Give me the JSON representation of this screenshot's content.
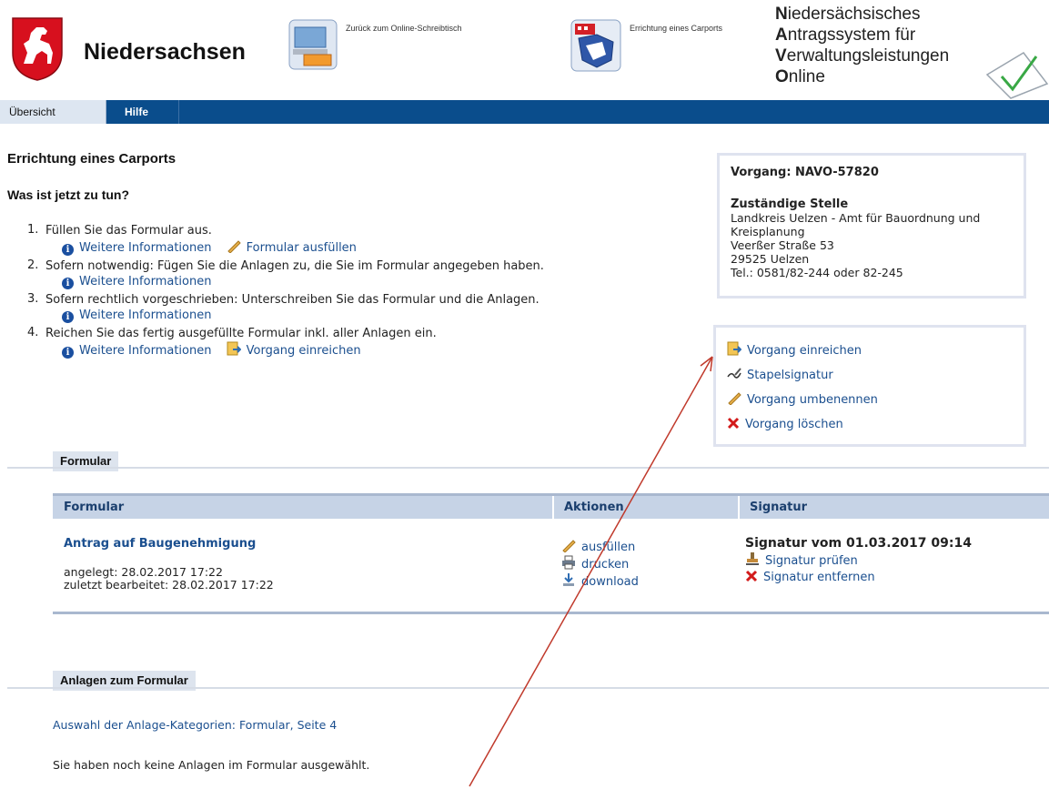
{
  "header": {
    "brand": "Niedersachsen",
    "back_link": "Zurück zum Online-Schreibtisch",
    "service_link": "Errichtung eines Carports",
    "navo_lines": [
      {
        "initial": "N",
        "rest": "iedersächsisches"
      },
      {
        "initial": "A",
        "rest": "ntragssystem für"
      },
      {
        "initial": "V",
        "rest": "erwaltungsleistungen"
      },
      {
        "initial": "O",
        "rest": "nline"
      }
    ]
  },
  "tabs": [
    {
      "label": "Übersicht",
      "active": true
    },
    {
      "label": "Hilfe",
      "active": false
    }
  ],
  "main": {
    "title": "Errichtung eines Carports",
    "subheading": "Was ist jetzt zu tun?",
    "steps": [
      {
        "num": "1.",
        "text": "Füllen Sie das Formular aus.",
        "info": "Weitere Informationen",
        "extra": "Formular ausfüllen"
      },
      {
        "num": "2.",
        "text": "Sofern notwendig: Fügen Sie die Anlagen zu, die Sie im Formular angegeben haben.",
        "info": "Weitere Informationen"
      },
      {
        "num": "3.",
        "text": "Sofern rechtlich vorgeschrieben: Unterschreiben Sie das Formular und die Anlagen.",
        "info": "Weitere Informationen"
      },
      {
        "num": "4.",
        "text": "Reichen Sie das fertig ausgefüllte Formular inkl. aller Anlagen ein.",
        "info": "Weitere Informationen",
        "extra": "Vorgang einreichen"
      }
    ]
  },
  "vorgang": {
    "label": "Vorgang: NAVO-57820",
    "stelle_label": "Zuständige Stelle",
    "address_lines": [
      "Landkreis Uelzen - Amt für Bauordnung und",
      "Kreisplanung",
      "Veerßer Straße 53",
      "29525 Uelzen",
      "Tel.: 0581/82-244 oder 82-245"
    ]
  },
  "actions": [
    {
      "label": "Vorgang einreichen",
      "icon": "submit-icon"
    },
    {
      "label": "Stapelsignatur",
      "icon": "batch-signature-icon"
    },
    {
      "label": "Vorgang umbenennen",
      "icon": "pencil-icon"
    },
    {
      "label": "Vorgang löschen",
      "icon": "delete-x-icon"
    }
  ],
  "formular_section": {
    "label": "Formular",
    "columns": [
      "Formular",
      "Aktionen",
      "Signatur"
    ],
    "row": {
      "title": "Antrag auf Baugenehmigung",
      "created": "angelegt: 28.02.2017 17:22",
      "edited": "zuletzt bearbeitet: 28.02.2017 17:22",
      "actions": [
        "ausfüllen",
        "drucken",
        "download"
      ],
      "signature_title": "Signatur vom 01.03.2017 09:14",
      "signature_actions": [
        "Signatur prüfen",
        "Signatur entfernen"
      ]
    }
  },
  "anlagen_section": {
    "label": "Anlagen zum Formular",
    "link": "Auswahl der Anlage-Kategorien: Formular, Seite 4",
    "empty_text": "Sie haben noch keine Anlagen im Formular ausgewählt."
  },
  "colors": {
    "tabbar": "#0a4d8c",
    "link": "#1b4f8f",
    "table_header": "#c6d3e6",
    "box_border": "#dfe3ef",
    "arrow": "#c0392b"
  }
}
